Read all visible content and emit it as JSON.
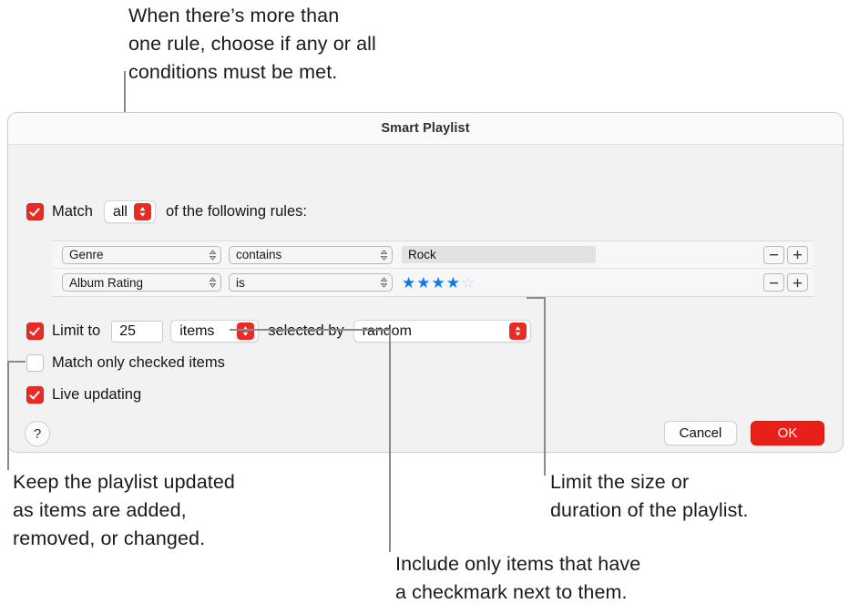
{
  "callouts": {
    "top": "When there’s more than\none rule, choose if any or all\nconditions must be met.",
    "bottom_left": "Keep the playlist updated\nas items are added,\nremoved, or changed.",
    "bottom_center": "Include only items that have\na checkmark next to them.",
    "bottom_right": "Limit the size or\nduration of the playlist."
  },
  "dialog": {
    "title": "Smart Playlist",
    "match": {
      "checked": true,
      "label": "Match",
      "value": "all",
      "suffix": "of the following rules:"
    },
    "rules": [
      {
        "field": "Genre",
        "operator": "contains",
        "value_type": "text",
        "value": "Rock",
        "remove_label": "−",
        "add_label": "+"
      },
      {
        "field": "Album Rating",
        "operator": "is",
        "value_type": "stars",
        "stars_filled": 4,
        "stars_total": 5,
        "remove_label": "−",
        "add_label": "+"
      }
    ],
    "limit": {
      "checked": true,
      "label": "Limit to",
      "amount": "25",
      "unit": "items",
      "middle_label": "selected by",
      "order": "random"
    },
    "match_only_checked": {
      "checked": false,
      "label": "Match only checked items"
    },
    "live_updating": {
      "checked": true,
      "label": "Live updating"
    },
    "buttons": {
      "help": "?",
      "cancel": "Cancel",
      "ok": "OK"
    }
  },
  "colors": {
    "accent_red": "#e8201a",
    "star_blue": "#1378ea",
    "star_empty": "#b9d4f5",
    "leader_gray": "#8a8a8a"
  }
}
